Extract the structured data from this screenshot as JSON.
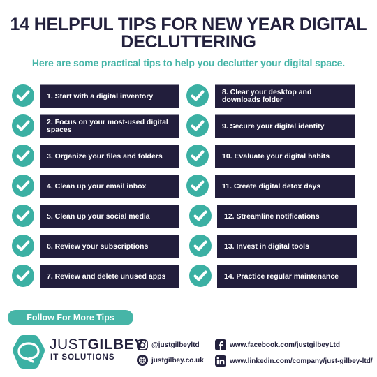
{
  "header": {
    "title_line1": "14 HELPFUL TIPS FOR NEW YEAR DIGITAL",
    "title_line2": "DECLUTTERING",
    "subtitle": "Here are some practical tips to help you declutter your digital space."
  },
  "colors": {
    "navy": "#221e3c",
    "teal": "#3bb0a3",
    "title": "#23213d",
    "subtitle": "#46b5a7"
  },
  "tips": [
    {
      "label": "1. Start with a digital inventory",
      "icon": "check-circle-icon"
    },
    {
      "label": "2. Focus on your most-used digital spaces",
      "icon": "check-circle-icon"
    },
    {
      "label": "3. Organize your files and folders",
      "icon": "check-circle-icon"
    },
    {
      "label": "4. Clean up your email inbox",
      "icon": "check-circle-icon"
    },
    {
      "label": "5. Clean up your social media",
      "icon": "check-circle-icon"
    },
    {
      "label": "6. Review your subscriptions",
      "icon": "check-circle-icon"
    },
    {
      "label": "7. Review and delete unused apps",
      "icon": "check-circle-icon"
    },
    {
      "label": "8. Clear your desktop and downloads folder",
      "icon": "check-circle-icon"
    },
    {
      "label": "9. Secure your digital identity",
      "icon": "check-circle-icon"
    },
    {
      "label": "10. Evaluate your digital habits",
      "icon": "check-circle-icon"
    },
    {
      "label": "11. Create digital detox days",
      "icon": "check-circle-icon"
    },
    {
      "label": "12. Streamline notifications",
      "icon": "check-circle-icon"
    },
    {
      "label": "13. Invest in digital tools",
      "icon": "check-circle-icon"
    },
    {
      "label": "14. Practice regular maintenance",
      "icon": "check-circle-icon"
    }
  ],
  "footer": {
    "follow_label": "Follow For More Tips",
    "brand_light": "JUST",
    "brand_bold": "GILBEY",
    "brand_sub": "IT SOLUTIONS",
    "instagram": {
      "icon": "instagram-icon",
      "text": "@justgilbeyltd"
    },
    "website": {
      "icon": "globe-icon",
      "text": "justgilbey.co.uk"
    },
    "facebook": {
      "icon": "facebook-icon",
      "text": "www.facebook.com/justgilbeyLtd"
    },
    "linkedin": {
      "icon": "linkedin-icon",
      "text": "www.linkedin.com/company/just-gilbey-ltd/"
    }
  }
}
